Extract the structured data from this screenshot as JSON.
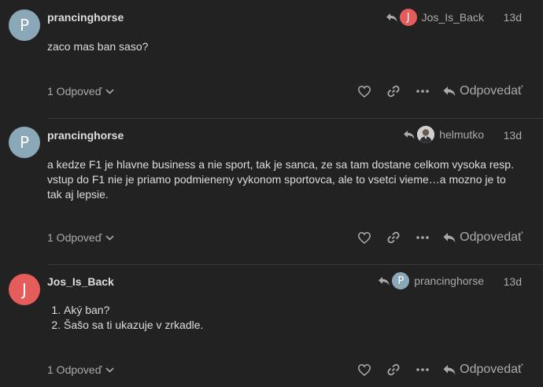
{
  "colors": {
    "background": "#222222",
    "avatar_p": "#8ba8b8",
    "avatar_j": "#e45d5a",
    "text": "#dddddd",
    "muted": "#aaaaaa"
  },
  "posts": [
    {
      "avatar_letter": "P",
      "username": "prancinghorse",
      "reply_to_avatar_letter": "J",
      "reply_to_user": "Jos_Is_Back",
      "date": "13d",
      "paragraphs": [
        "zaco mas ban saso?"
      ],
      "replies_label": "1 Odpoveď",
      "reply_label": "Odpovedať"
    },
    {
      "avatar_letter": "P",
      "username": "prancinghorse",
      "reply_to_avatar_letter": "",
      "reply_to_user": "helmutko",
      "date": "13d",
      "paragraphs": [
        "a kedze F1 je hlavne business a nie sport, tak je sanca, ze sa tam dostane celkom vysoka resp. vstup do F1 nie je priamo podmieneny vykonom sportovca, ale to vsetci vieme…a mozno je to tak aj lepsie."
      ],
      "replies_label": "1 Odpoveď",
      "reply_label": "Odpovedať"
    },
    {
      "avatar_letter": "J",
      "username": "Jos_Is_Back",
      "reply_to_avatar_letter": "P",
      "reply_to_user": "prancinghorse",
      "date": "13d",
      "list_items": [
        "Aký ban?",
        "Šašo sa ti ukazuje v zrkadle."
      ],
      "replies_label": "1 Odpoveď",
      "reply_label": "Odpovedať"
    }
  ]
}
